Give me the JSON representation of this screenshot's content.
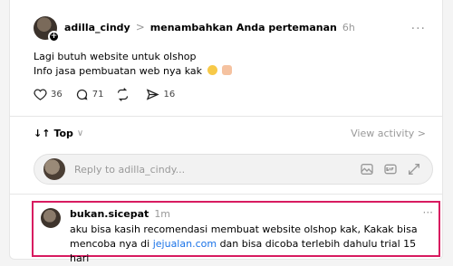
{
  "post": {
    "username": "adilla_cindy",
    "separator": ">",
    "action": "menambahkan Anda pertemanan",
    "time": "6h",
    "more": "···",
    "line1": "Lagi butuh website untuk olshop",
    "line2": "Info jasa pembuatan web nya kak",
    "emojis": [
      "grinning-face",
      "hands"
    ]
  },
  "stats": {
    "likes": "36",
    "comments": "71",
    "reposts": "",
    "shares": "16"
  },
  "sort": {
    "label": "Top",
    "icon": "↓↑",
    "chevron": "∨"
  },
  "view_activity": "View activity >",
  "reply": {
    "placeholder": "Reply to adilla_cindy..."
  },
  "comment": {
    "username": "bukan.sicepat",
    "time": "1m",
    "more": "···",
    "text_pre": "aku bisa kasih recomendasi membuat website olshop kak, Kakak bisa mencoba nya di ",
    "link": "jejualan.com",
    "text_post": " dan bisa dicoba terlebih dahulu trial 15 hari"
  },
  "colors": {
    "highlight": "#d81b60",
    "link": "#1a73e8",
    "muted": "#999999"
  }
}
